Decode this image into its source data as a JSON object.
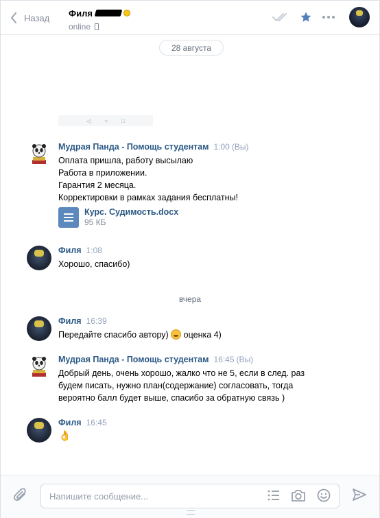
{
  "header": {
    "back_label": "Назад",
    "peer_name": "Филя",
    "peer_status": "online"
  },
  "date_pill": "28 августа",
  "messages": [
    {
      "author": "Мудрая Панда - Помощь студентам",
      "time": "1:00",
      "you": "(Вы)",
      "lines": [
        "Оплата пришла, работу высылаю",
        "Работа в приложении.",
        "Гарантия 2 месяца.",
        "Корректировки в рамках задания бесплатны!"
      ],
      "attachment": {
        "name": "Курс. Судимость.docx",
        "size": "95 КБ"
      }
    },
    {
      "author": "Филя",
      "time": "1:08",
      "lines": [
        "Хорошо, спасибо)"
      ]
    },
    {
      "author": "Филя",
      "time": "16:39",
      "text_before": "Передайте спасибо автору)",
      "text_after": "оценка 4)"
    },
    {
      "author": "Мудрая Панда - Помощь студентам",
      "time": "16:45",
      "you": "(Вы)",
      "lines": [
        "Добрый день, очень хорошо, жалко что не 5, если в след. раз",
        "будем писать, нужно план(содержание) согласовать, тогда",
        "вероятно балл будет выше, спасибо за обратную связь )"
      ]
    },
    {
      "author": "Филя",
      "time": "16:45",
      "lines": [
        "👌"
      ]
    }
  ],
  "divider": "вчера",
  "composer": {
    "placeholder": "Напишите сообщение..."
  },
  "colors": {
    "link": "#2a5885",
    "accent": "#5181b8",
    "muted": "#828a99"
  }
}
